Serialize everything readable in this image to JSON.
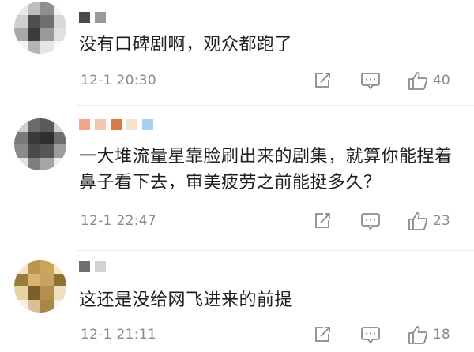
{
  "comments": [
    {
      "text": "没有口碑剧啊，观众都跑了",
      "date": "12-1 20:30",
      "likes": "40",
      "avatar_colors": [
        "#e9e9e9",
        "#bdbdbd",
        "#8f8f8f",
        "#f2f2f2",
        "#cfcfcf",
        "#4f4f4f",
        "#707070",
        "#d8d8d8",
        "#a8a8a8",
        "#3c3c3c",
        "#9a9a9a",
        "#e0e0e0",
        "#f3f3f3",
        "#b5b5b5",
        "#e6e6e6",
        "#fafafa"
      ],
      "username_colors": [
        "#4a4a4a",
        "#9a9a9a"
      ]
    },
    {
      "text": "一大堆流量星靠脸刷出来的剧集，就算你能捏着鼻子看下去，审美疲劳之前能挺多久？",
      "date": "12-1 22:47",
      "likes": "23",
      "avatar_colors": [
        "#cfcfcf",
        "#6b6b6b",
        "#5a5a5a",
        "#d2d2d2",
        "#7a7a7a",
        "#3a3a3a",
        "#2f2f2f",
        "#6e6e6e",
        "#8a8a8a",
        "#4a4a4a",
        "#565656",
        "#9c9c9c",
        "#e2e2e2",
        "#7e7e7e",
        "#a5a5a5",
        "#ededed"
      ],
      "username_colors": [
        "#f3a78a",
        "#f1c7b0",
        "#d37b4a",
        "#f7e3c9",
        "#a9d1ef"
      ]
    },
    {
      "text": "这还是没给网飞进来的前提",
      "date": "12-1 21:11",
      "likes": "18",
      "avatar_colors": [
        "#f1e4c8",
        "#b99650",
        "#caa55a",
        "#f4e6c2",
        "#9b7a3e",
        "#d9b46a",
        "#c7a363",
        "#8e6f35",
        "#e6d2a6",
        "#7c5f2a",
        "#b48e4c",
        "#efe0bd",
        "#f7efdc",
        "#d8c294",
        "#a88548",
        "#fbf4e6"
      ],
      "username_colors": [
        "#6f6f6f",
        "#d2d2d2"
      ]
    }
  ],
  "icons": {
    "share": "share-icon",
    "comment": "comment-icon",
    "like": "thumbs-up-icon"
  }
}
